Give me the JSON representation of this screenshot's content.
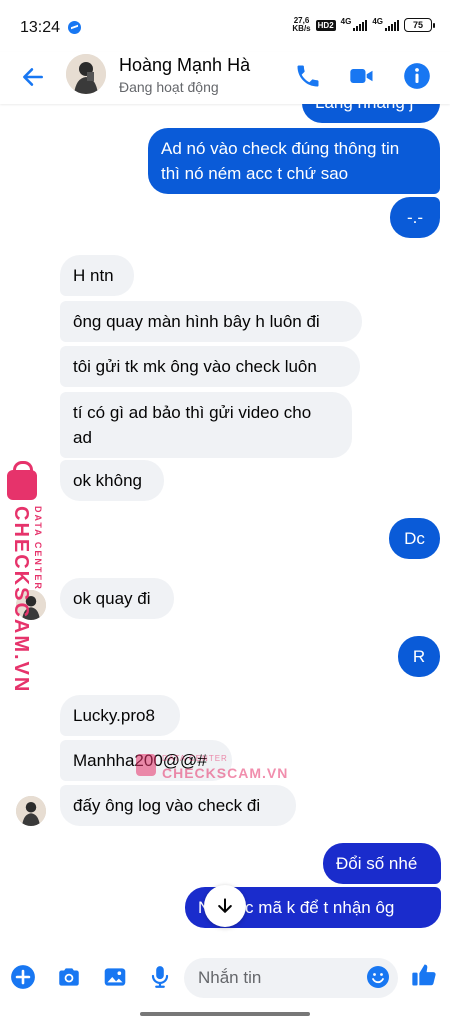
{
  "status_bar": {
    "time": "13:24",
    "net_speed_value": "27,6",
    "net_speed_unit": "KB/s",
    "hd_badge": "HD2",
    "lte_1": "4G",
    "lte_2": "4G",
    "battery": "75"
  },
  "header": {
    "contact_name": "Hoàng Mạnh Hà",
    "contact_status": "Đang hoạt động"
  },
  "messages": {
    "m0": "Lăng nhăng j",
    "m1": "Ad nó vào check đúng thông tin\nthì nó ném acc t chứ sao",
    "m2": "-.-",
    "m3": "H ntn",
    "m4": "ông quay màn hình bây h luôn đi",
    "m5": "tôi gửi tk mk ông vào check luôn",
    "m6": "tí có gì ad bảo thì gửi video cho\nad",
    "m7": "ok không",
    "m8": "Dc",
    "m9": "ok quay đi",
    "m10": "R",
    "m11": "Lucky.pro8",
    "m12": "Manhha200@@#",
    "m13": "đấy ông log vào check đi",
    "m14": "Đổi số nhé",
    "m15": "Nhỡ dc mã k để t nhận ôg"
  },
  "watermark": {
    "brand": "CHECKSCAM.VN",
    "tagline": "DATA CENTER"
  },
  "composer": {
    "placeholder": "Nhắn tin"
  },
  "colors": {
    "accent": "#1877f2",
    "outgoing_bubble": "#0a5bd8",
    "incoming_bubble": "#f0f2f5",
    "watermark": "#e6336b"
  },
  "icons": [
    "messenger-icon",
    "back-arrow-icon",
    "phone-icon",
    "video-call-icon",
    "info-icon",
    "arrow-down-icon",
    "plus-circle-icon",
    "camera-icon",
    "gallery-icon",
    "microphone-icon",
    "emoji-icon",
    "thumbs-up-icon"
  ]
}
